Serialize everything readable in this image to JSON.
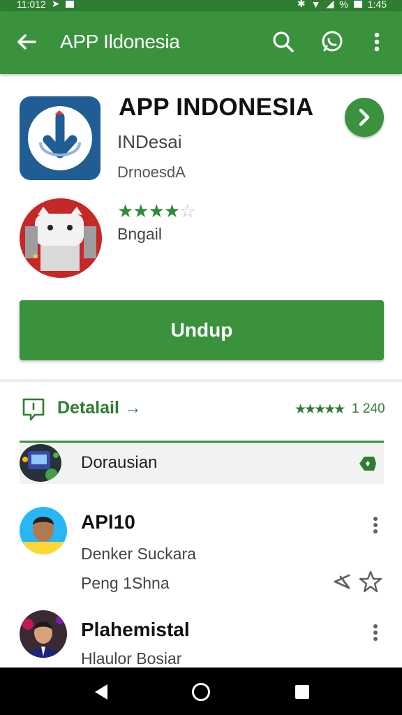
{
  "status_bar": {
    "time_left": "11:012",
    "time_right": "1:45",
    "battery": "%"
  },
  "app_bar": {
    "title": "APP Ildonesia",
    "icons": {
      "back": "arrow-back-icon",
      "search": "search-icon",
      "chat": "chat-icon",
      "menu": "more-vert-icon"
    }
  },
  "hero": {
    "title": "APP INDONESIA",
    "subtitle_1": "INDesai",
    "subtitle_2": "DrnoesdA",
    "stars": "★★★★",
    "stars_empty": "☆",
    "rating_value": 4,
    "rating_max": 5,
    "rating_label": "Bngail"
  },
  "install_button": {
    "label": "Undup"
  },
  "details": {
    "label": "Detalail →",
    "stars": "★★★★★",
    "count": "1 240"
  },
  "highlight": {
    "label": "Dorausian"
  },
  "list": [
    {
      "title": "APl10",
      "sub_1": "Denker Suckara",
      "sub_2": "Peng 1Shna"
    },
    {
      "title": "Plahemistal",
      "sub_1": "Hlaulor Bosiar"
    }
  ],
  "colors": {
    "primary": "#3a923d",
    "primary_dark": "#2e7d32",
    "star": "#2e8b3a",
    "hero_icon_bg": "#1f5d94",
    "second_icon_bg": "#c62828"
  }
}
